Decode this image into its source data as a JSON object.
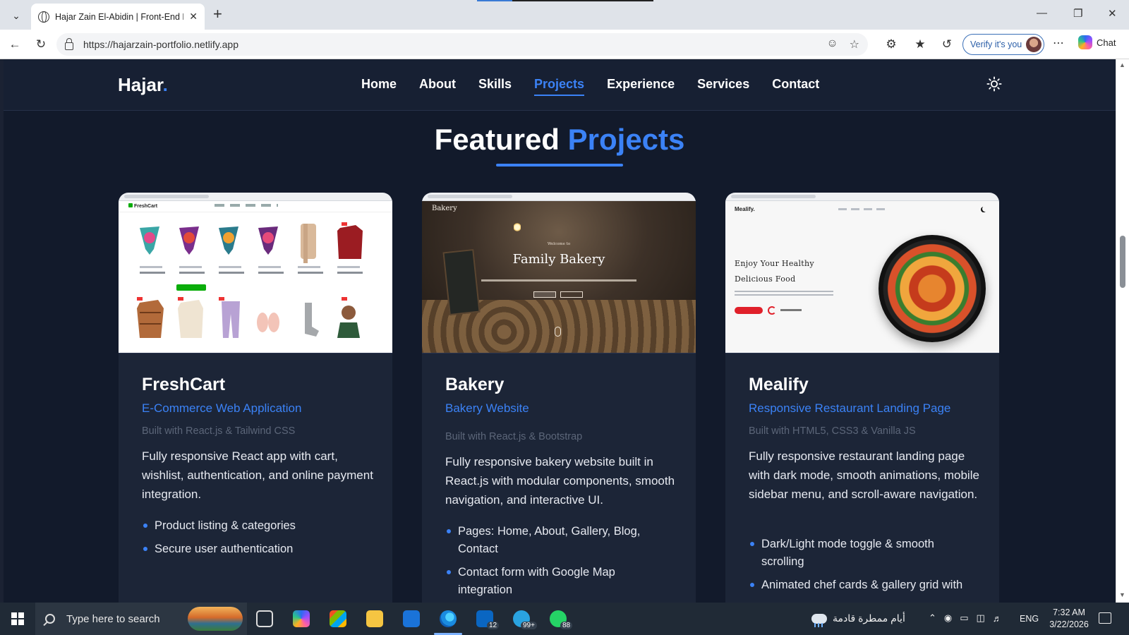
{
  "browser": {
    "tab_title": "Hajar Zain El-Abidin | Front-End De",
    "url": "https://hajarzain-portfolio.netlify.app",
    "verify_label": "Verify it's you",
    "chat_label": "Chat"
  },
  "site": {
    "logo": "Hajar",
    "logo_dot": ".",
    "nav": [
      "Home",
      "About",
      "Skills",
      "Projects",
      "Experience",
      "Services",
      "Contact"
    ],
    "active_nav": "Projects",
    "section_title_1": "Featured",
    "section_title_2": "Projects",
    "accent_color": "#3b82f6",
    "projects": [
      {
        "title": "FreshCart",
        "subtitle": "E-Commerce Web Application",
        "tech": "Built with React.js & Tailwind CSS",
        "description": "Fully responsive React app with cart, wishlist, authentication, and online payment integration.",
        "features": [
          "Product listing & categories",
          "Secure user authentication"
        ],
        "thumb_logo": "FreshCart"
      },
      {
        "title": "Bakery",
        "subtitle": "Bakery Website",
        "tech": "Built with React.js & Bootstrap",
        "description": "Fully responsive bakery website built in React.js with modular components, smooth navigation, and interactive UI.",
        "features": [
          "Pages: Home, About, Gallery, Blog, Contact",
          "Contact form with Google Map integration"
        ],
        "thumb_logo": "Bakery",
        "thumb_welcome": "Welcome to",
        "thumb_title": "Family Bakery"
      },
      {
        "title": "Mealify",
        "subtitle": "Responsive Restaurant Landing Page",
        "tech": "Built with HTML5, CSS3 & Vanilla JS",
        "description": "Fully responsive restaurant landing page with dark mode, smooth animations, mobile sidebar menu, and scroll-aware navigation.",
        "features": [
          "Dark/Light mode toggle & smooth scrolling",
          "Animated chef cards & gallery grid with"
        ],
        "thumb_logo": "Mealify.",
        "thumb_heading_1": "Enjoy Your Healthy",
        "thumb_heading_2": "Delicious Food"
      }
    ]
  },
  "taskbar": {
    "search_placeholder": "Type here to search",
    "linkedin_badge": "12",
    "telegram_badge": "99+",
    "whatsapp_badge": "88",
    "weather": "أيام ممطرة قادمة",
    "language": "ENG",
    "time": "7:32 AM",
    "date": "3/22/2026"
  }
}
